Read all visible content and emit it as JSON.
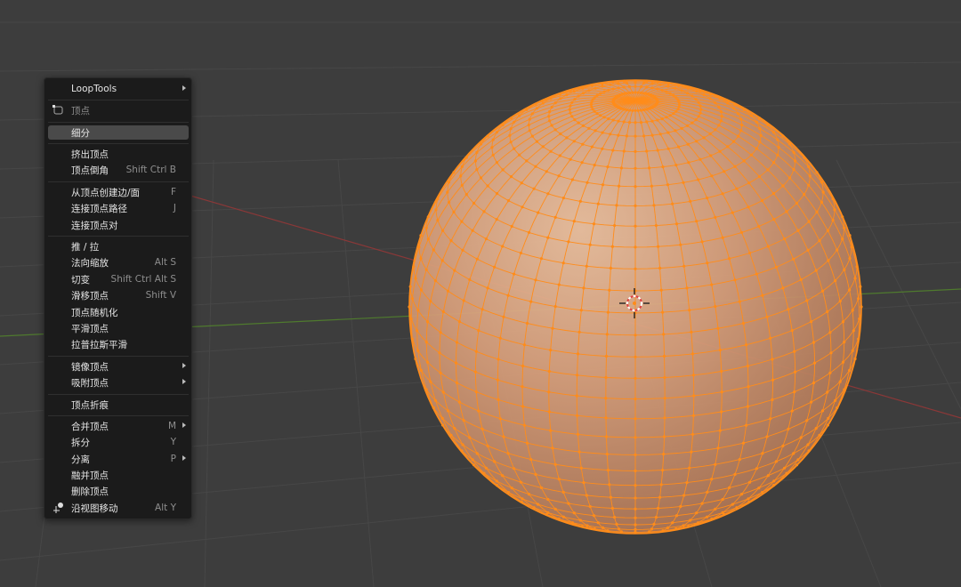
{
  "menu": {
    "items": [
      {
        "label": "LoopTools",
        "arrow": true
      },
      {
        "label": "顶点",
        "header": true,
        "icon": "vertex-select-icon"
      },
      {
        "label": "细分",
        "active": true
      },
      {
        "label": "挤出顶点"
      },
      {
        "label": "顶点倒角",
        "shortcut": "Shift Ctrl B"
      },
      {
        "label": "从顶点创建边/面",
        "shortcut": "F"
      },
      {
        "label": "连接顶点路径",
        "shortcut": "J"
      },
      {
        "label": "连接顶点对"
      },
      {
        "label": "推 / 拉"
      },
      {
        "label": "法向缩放",
        "shortcut": "Alt S"
      },
      {
        "label": "切变",
        "shortcut": "Shift Ctrl Alt S"
      },
      {
        "label": "滑移顶点",
        "shortcut": "Shift V"
      },
      {
        "label": "顶点随机化"
      },
      {
        "label": "平滑顶点"
      },
      {
        "label": "拉普拉斯平滑"
      },
      {
        "label": "镜像顶点",
        "arrow": true
      },
      {
        "label": "吸附顶点",
        "arrow": true
      },
      {
        "label": "顶点折痕"
      },
      {
        "label": "合并顶点",
        "shortcut": "M",
        "arrow": true
      },
      {
        "label": "拆分",
        "shortcut": "Y"
      },
      {
        "label": "分离",
        "shortcut": "P",
        "arrow": true
      },
      {
        "label": "融并顶点"
      },
      {
        "label": "删除顶点"
      },
      {
        "label": "沿视图移动",
        "shortcut": "Alt Y",
        "icon": "slide-view-icon"
      }
    ]
  },
  "colors": {
    "background": "#3d3d3d",
    "menu_bg": "#1b1b1b",
    "selection": "#ff8c1a",
    "mesh_face": "#e8a070"
  }
}
